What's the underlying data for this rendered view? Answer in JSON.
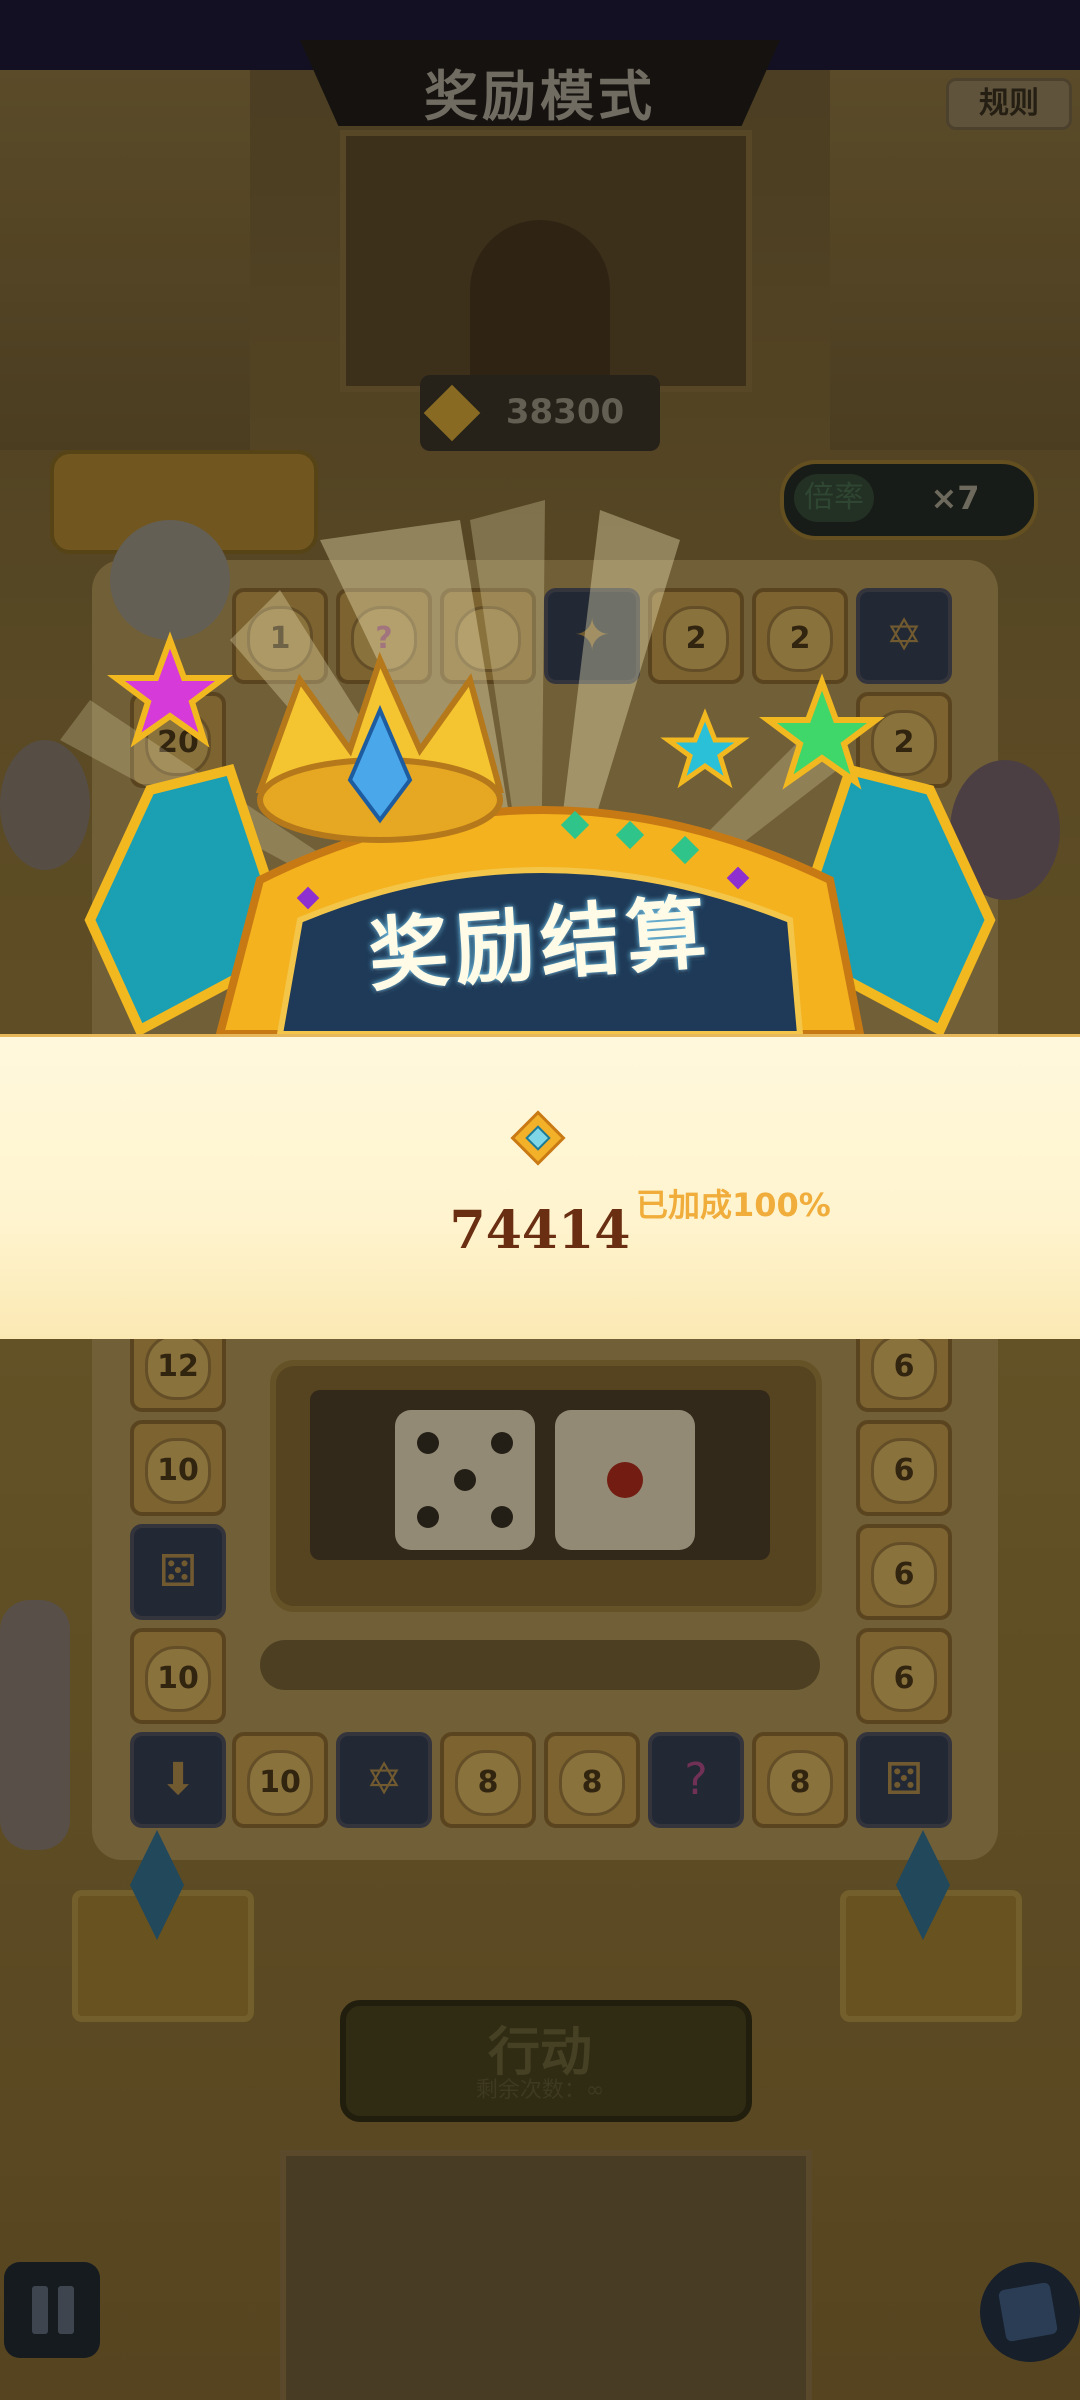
{
  "header": {
    "title": "奖励模式",
    "rules_label": "规则"
  },
  "score": {
    "value": "38300"
  },
  "multiplier": {
    "label": "倍率",
    "value": "×7"
  },
  "board": {
    "top_row": [
      "1",
      "?",
      "",
      "",
      "2",
      "2",
      "star"
    ],
    "left_col": [
      "20",
      "12",
      "10",
      "dice",
      "10"
    ],
    "right_col": [
      "2",
      "6",
      "6",
      "6",
      "6"
    ],
    "bottom_row": [
      "arrow",
      "10",
      "star",
      "8",
      "8",
      "?",
      "8",
      "dice"
    ]
  },
  "dice": {
    "die1": 5,
    "die2": 1
  },
  "action": {
    "label": "行动",
    "sub": "剩余次数：∞"
  },
  "result": {
    "banner_title": "奖励结算",
    "amount": "74414",
    "bonus": "已加成100%"
  },
  "colors": {
    "panel_bg": "#fff6d6",
    "amount": "#6a2e12",
    "bonus": "#f0ad3c"
  }
}
